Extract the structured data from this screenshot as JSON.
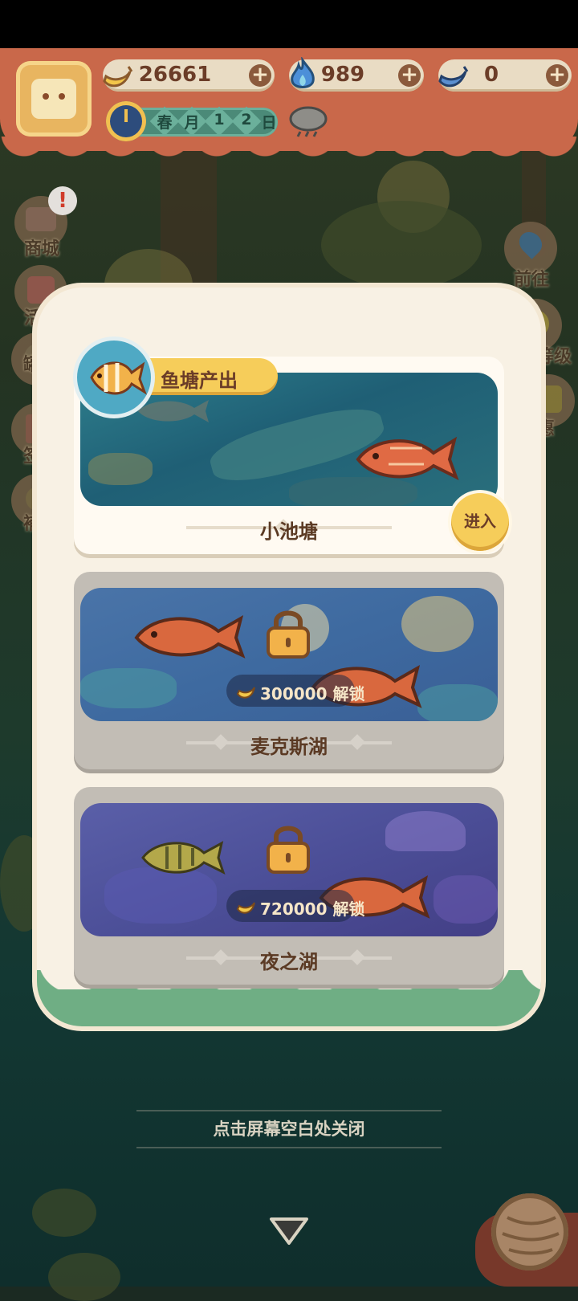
{
  "header": {
    "resources": [
      {
        "icon": "banana-icon",
        "value": "26661"
      },
      {
        "icon": "blue-flame-icon",
        "value": "989"
      },
      {
        "icon": "blue-banana-icon",
        "value": "0"
      }
    ],
    "date": [
      "春",
      "月",
      "1",
      "2",
      "日"
    ],
    "weather_icon": "rain-cloud-icon",
    "add_symbol": "+"
  },
  "sidebar_left": [
    {
      "label": "商城",
      "icon": "shop-icon"
    },
    {
      "label": "活动",
      "icon": "gift-icon"
    },
    {
      "label": "罐",
      "icon": "jar-icon"
    },
    {
      "label": "签",
      "icon": "sign-icon"
    },
    {
      "label": "補",
      "icon": "supply-icon"
    }
  ],
  "sidebar_right": [
    {
      "label": "前往",
      "icon": "map-pin-icon"
    },
    {
      "label": "等级",
      "icon": "level-icon"
    },
    {
      "label": "惠",
      "icon": "offer-icon"
    }
  ],
  "badge": "!",
  "modal": {
    "tag_label": "鱼塘产出",
    "ponds": [
      {
        "name": "小池塘",
        "locked": false,
        "enter_label": "进入"
      },
      {
        "name": "麦克斯湖",
        "locked": true,
        "unlock_label": "300000 解锁"
      },
      {
        "name": "夜之湖",
        "locked": true,
        "unlock_label": "720000 解锁"
      }
    ]
  },
  "close_hint": "点击屏幕空白处关闭",
  "colors": {
    "header": "#c9684a",
    "modal_bg": "#f8f1e4",
    "accent_yellow": "#f6cd5a",
    "text_brown": "#5b3a24"
  }
}
